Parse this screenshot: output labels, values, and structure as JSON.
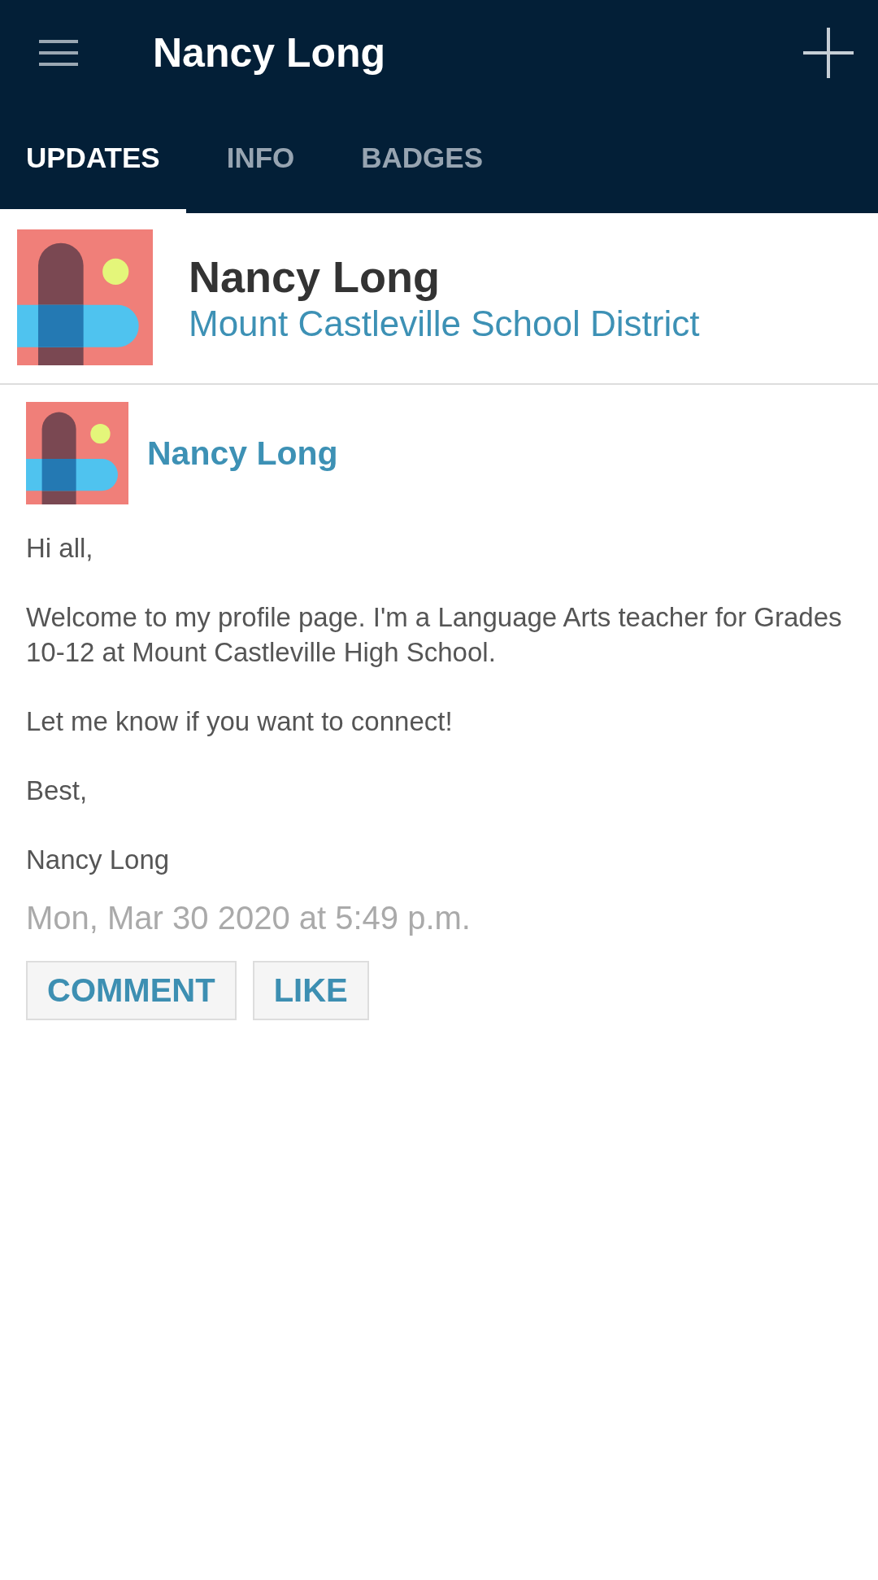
{
  "app_bar": {
    "title": "Nancy Long"
  },
  "tabs": [
    {
      "label": "UPDATES",
      "selected": true
    },
    {
      "label": "INFO",
      "selected": false
    },
    {
      "label": "BADGES",
      "selected": false
    }
  ],
  "profile": {
    "name": "Nancy Long",
    "organization": "Mount Castleville School District"
  },
  "post": {
    "author": "Nancy Long",
    "paragraphs": [
      "Hi all,",
      "Welcome to my profile page. I'm a Language Arts teacher for Grades 10-12 at Mount Castleville High School.",
      "Let me know if you want to connect!",
      "Best,",
      "Nancy Long"
    ],
    "timestamp": "Mon, Mar 30 2020 at 5:49 p.m.",
    "actions": [
      "COMMENT",
      "LIKE"
    ]
  }
}
